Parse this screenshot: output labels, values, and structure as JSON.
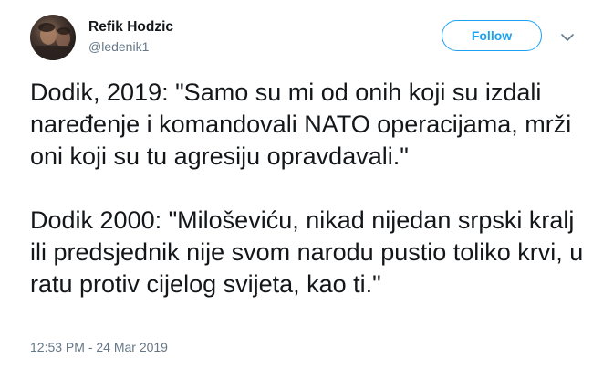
{
  "author": {
    "name": "Refik Hodzic",
    "handle": "@ledenik1"
  },
  "follow_button": {
    "label": "Follow",
    "color": "#1da1f2"
  },
  "menu": {
    "icon": "chevron-down-icon"
  },
  "tweet": {
    "paragraphs": [
      "Dodik, 2019: \"Samo su mi od onih koji su izdali naređenje i komandovali NATO operacijama, mrži oni koji su tu agresiju opravdavali.\"",
      "Dodik 2000: \"Miloševiću, nikad nijedan srpski kralj ili predsjednik nije svom narodu pustio toliko krvi, u ratu protiv cijelog svijeta, kao ti.\""
    ],
    "timestamp": "12:53 PM - 24 Mar 2019"
  }
}
